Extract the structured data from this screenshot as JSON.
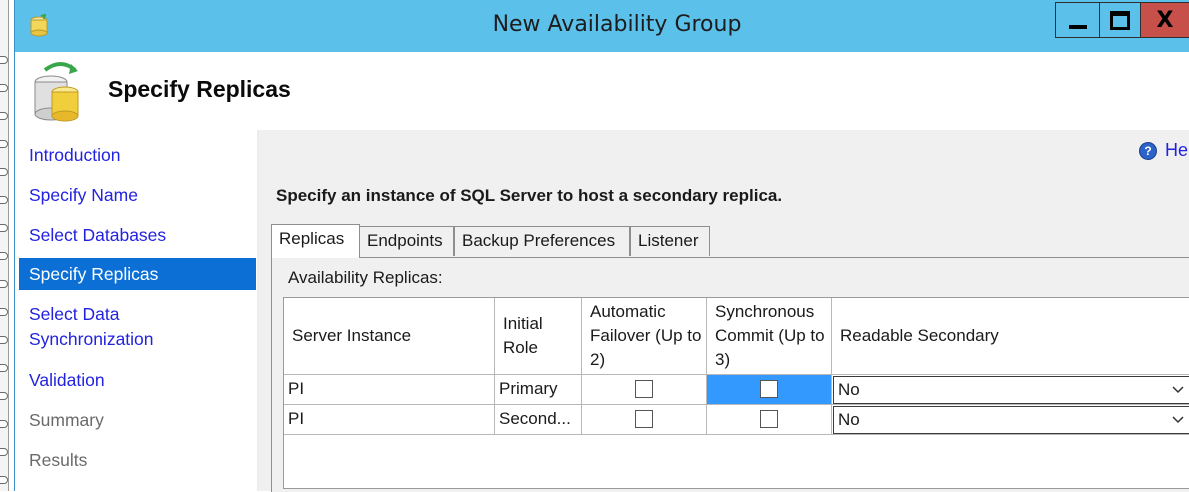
{
  "window": {
    "title": "New Availability Group",
    "page_title": "Specify Replicas",
    "controls": {
      "minimize": "minimize",
      "maximize": "maximize",
      "close": "X"
    }
  },
  "sidebar": {
    "items": [
      {
        "label": "Introduction",
        "state": "link"
      },
      {
        "label": "Specify Name",
        "state": "link"
      },
      {
        "label": "Select Databases",
        "state": "link"
      },
      {
        "label": "Specify Replicas",
        "state": "active"
      },
      {
        "label": "Select Data Synchronization",
        "state": "link"
      },
      {
        "label": "Validation",
        "state": "link"
      },
      {
        "label": "Summary",
        "state": "disabled"
      },
      {
        "label": "Results",
        "state": "disabled"
      }
    ]
  },
  "main": {
    "help_label": "Help",
    "instruction": "Specify an instance of SQL Server to host a secondary replica.",
    "tabs": [
      {
        "label": "Replicas",
        "active": true
      },
      {
        "label": "Endpoints",
        "active": false
      },
      {
        "label": "Backup Preferences",
        "active": false
      },
      {
        "label": "Listener",
        "active": false
      }
    ],
    "replicas_label": "Availability Replicas:",
    "table": {
      "columns": [
        "Server Instance",
        "Initial Role",
        "Automatic Failover (Up to 2)",
        "Synchronous Commit (Up to 3)",
        "Readable Secondary"
      ],
      "rows": [
        {
          "server_instance": "PI",
          "initial_role": "Primary",
          "automatic_failover": false,
          "synchronous_commit": false,
          "readable_secondary": "No"
        },
        {
          "server_instance": "PI",
          "initial_role": "Second...",
          "automatic_failover": false,
          "synchronous_commit": false,
          "readable_secondary": "No"
        }
      ]
    }
  },
  "colors": {
    "titlebar": "#5bc0ea",
    "close_button": "#c7504a",
    "nav_active": "#0b6fd6",
    "link": "#2222e0",
    "selected_cell": "#3399ff"
  }
}
